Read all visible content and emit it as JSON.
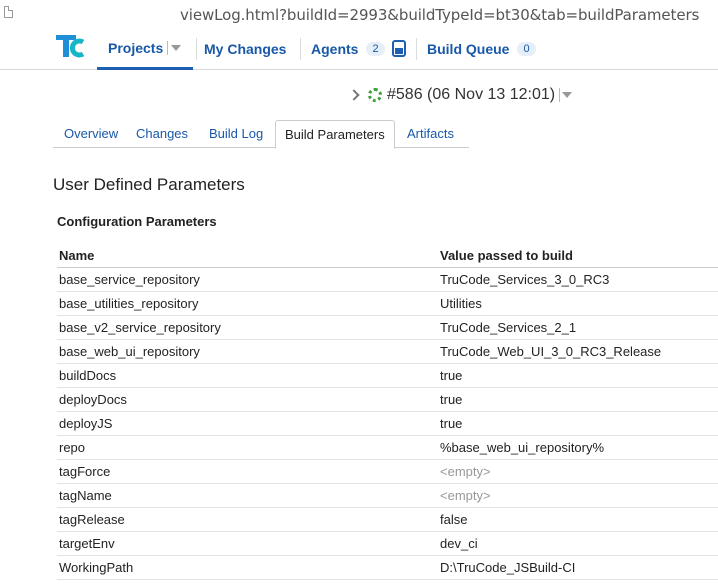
{
  "address_bar": {
    "url": "viewLog.html?buildId=2993&buildTypeId=bt30&tab=buildParameters"
  },
  "nav": {
    "logo": "TC",
    "projects": "Projects",
    "my_changes": "My Changes",
    "agents": "Agents",
    "agents_count": "2",
    "build_queue": "Build Queue",
    "build_queue_count": "0"
  },
  "build": {
    "label": "#586 (06 Nov 13 12:01)"
  },
  "tabs": [
    {
      "label": "Overview"
    },
    {
      "label": "Changes"
    },
    {
      "label": "Build Log"
    },
    {
      "label": "Build Parameters",
      "active": true
    },
    {
      "label": "Artifacts"
    }
  ],
  "section_title": "User Defined Parameters",
  "subsection_title": "Configuration Parameters",
  "table": {
    "headers": [
      "Name",
      "Value passed to build"
    ],
    "rows": [
      {
        "name": "base_service_repository",
        "value": "TruCode_Services_3_0_RC3"
      },
      {
        "name": "base_utilities_repository",
        "value": "Utilities"
      },
      {
        "name": "base_v2_service_repository",
        "value": "TruCode_Services_2_1"
      },
      {
        "name": "base_web_ui_repository",
        "value": "TruCode_Web_UI_3_0_RC3_Release"
      },
      {
        "name": "buildDocs",
        "value": "true"
      },
      {
        "name": "deployDocs",
        "value": "true"
      },
      {
        "name": "deployJS",
        "value": "true"
      },
      {
        "name": "repo",
        "value": "%base_web_ui_repository%"
      },
      {
        "name": "tagForce",
        "value": "<empty>",
        "empty": true
      },
      {
        "name": "tagName",
        "value": "<empty>",
        "empty": true
      },
      {
        "name": "tagRelease",
        "value": "false"
      },
      {
        "name": "targetEnv",
        "value": "dev_ci"
      },
      {
        "name": "WorkingPath",
        "value": "D:\\TruCode_JSBuild-CI"
      }
    ]
  },
  "colors": {
    "link": "#1858a8",
    "accent": "#1d5fb3",
    "success": "#3da03d"
  }
}
